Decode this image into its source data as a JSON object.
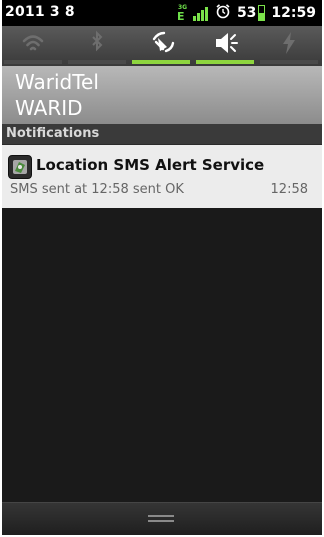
{
  "status_bar": {
    "date": "2011 3 8",
    "network_type_top": "3G",
    "network_type": "E",
    "battery_level": "53",
    "time": "12:59",
    "icons": [
      "network-type-icon",
      "signal-icon",
      "alarm-icon",
      "battery-icon"
    ]
  },
  "quick_toggles": [
    {
      "name": "wifi",
      "icon": "wifi-icon",
      "on": false
    },
    {
      "name": "bluetooth",
      "icon": "bluetooth-icon",
      "on": false
    },
    {
      "name": "gps",
      "icon": "gps-icon",
      "on": true
    },
    {
      "name": "sound",
      "icon": "sound-icon",
      "on": true
    },
    {
      "name": "flash",
      "icon": "flash-icon",
      "on": false
    }
  ],
  "carrier": {
    "line1": "WaridTel",
    "line2": "WARID"
  },
  "notifications": {
    "header": "Notifications",
    "items": [
      {
        "icon": "app-icon",
        "title": "Location SMS Alert Service",
        "text": "SMS sent at 12:58 sent OK",
        "time": "12:58"
      }
    ]
  },
  "colors": {
    "toggle_on": "#8ed53f",
    "signal": "#7be24a",
    "background": "#1a1a1a",
    "notification_bg": "#ececec"
  }
}
